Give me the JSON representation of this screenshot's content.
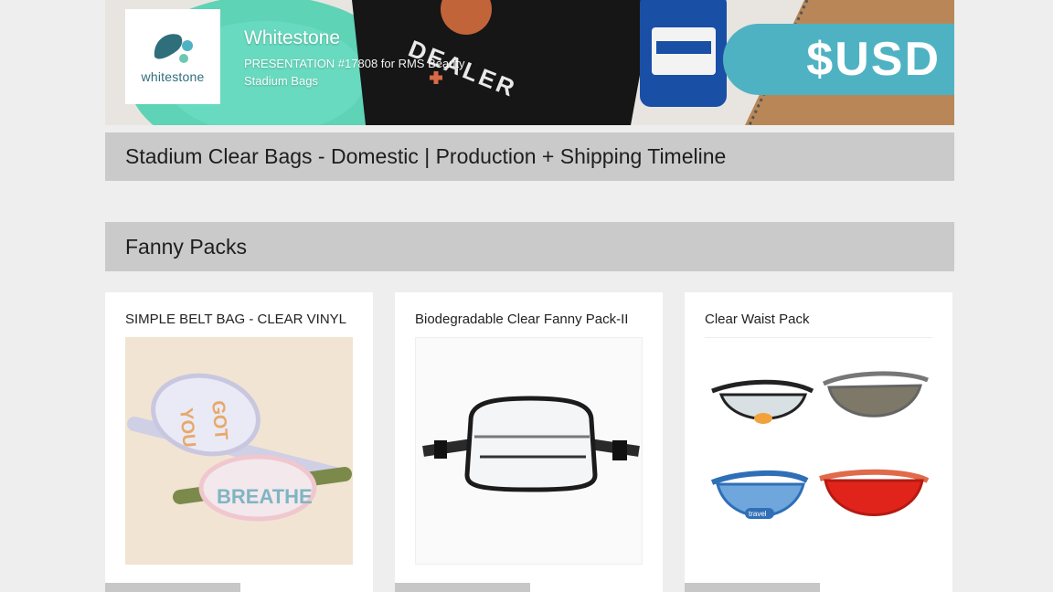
{
  "header": {
    "company": "Whitestone",
    "logo_text": "whitestone",
    "presentation_line": "PRESENTATION #17808 for RMS Beauty",
    "category": "Stadium Bags",
    "currency": "$USD",
    "currency_color": "#4fb2c3"
  },
  "timeline_bar": {
    "title": "Stadium Clear Bags - Domestic | Production + Shipping Timeline"
  },
  "section": {
    "title": "Fanny Packs"
  },
  "products": [
    {
      "name": "SIMPLE BELT BAG - CLEAR VINYL",
      "image": "clear-belt-bags-photo",
      "image_text": "BREATHE"
    },
    {
      "name": "Biodegradable Clear Fanny Pack-II",
      "image": "clear-fanny-pack-photo"
    },
    {
      "name": "Clear Waist Pack",
      "image": "waist-pack-colors-photo",
      "image_text": "travel"
    }
  ],
  "colors": {
    "page_bg": "#eeeeee",
    "bar_bg": "#cacaca",
    "card_bg": "#ffffff"
  }
}
